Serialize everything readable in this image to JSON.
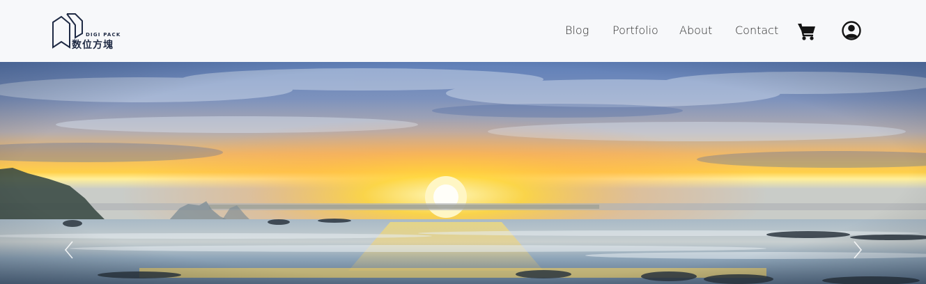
{
  "brand": {
    "sub_text": "DIGI PACK",
    "main_text": "数位方塊"
  },
  "nav": {
    "items": [
      {
        "label": "Blog"
      },
      {
        "label": "Portfolio"
      },
      {
        "label": "About"
      },
      {
        "label": "Contact"
      }
    ],
    "cart_icon": "shopping-cart-icon",
    "user_icon": "user-account-icon"
  },
  "hero": {
    "scene": "sunset-over-ocean",
    "prev_icon": "chevron-left-icon",
    "next_icon": "chevron-right-icon"
  },
  "colors": {
    "navbar_bg": "#f7f8fa",
    "text": "#2b2b2b",
    "brand": "#1f2a44",
    "sun": "#ffd84a"
  }
}
